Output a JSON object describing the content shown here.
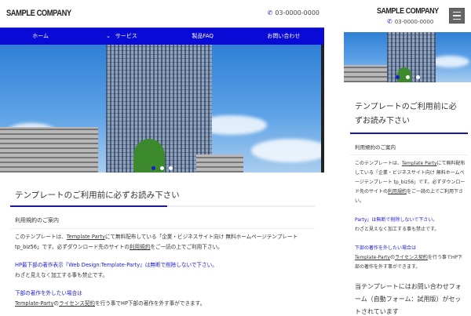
{
  "company": "SAMPLE COMPANY",
  "phone": "03-0000-0000",
  "icons": {
    "phone": "phone-icon",
    "menu": "hamburger-menu-icon",
    "dropdown": "chevron-down-icon"
  },
  "colors": {
    "accent": "#0a0ad6",
    "link_text": "#1a1acc"
  },
  "nav": [
    {
      "label": "ホーム"
    },
    {
      "label": "サービス",
      "has_dropdown": true
    },
    {
      "label": "製品FAQ"
    },
    {
      "label": "お問い合わせ"
    }
  ],
  "slider": {
    "slides": 3,
    "active": 1
  },
  "content": {
    "title": "テンプレートのご利用前に必ずお読み下さい",
    "subtitle": "利用規約のご案内",
    "p1_a": "このテンプレートは、",
    "p1_link": "Template Party",
    "p1_b": "にて無料配布している「企業・ビジネスサイト向け 無料ホームページテンプレート tp_biz56」です。必ずダウンロード先のサイトの",
    "p1_link2": "利用規約",
    "p1_c": "をご一読の上でご利用下さい。",
    "p2_blue": "HP最下部の著作表示『Web Design:Template-Party』は無断で削除しないで下さい。",
    "p2_blue_mobile": "Party』は無断で削除しないで下さい。",
    "p2": "わざと見えなく加工する事も禁止です。",
    "p3_blue": "下部の著作を外したい場合は",
    "p3_link": "Template-Party",
    "p3_a": "の",
    "p3_link2": "ライセンス契約",
    "p3_b": "を行う事でHP下部の著作を外す事ができます。",
    "form_note": "当テンプレートにはお問い合わせフォーム（自動フォーム：試用版）がセットされています"
  }
}
